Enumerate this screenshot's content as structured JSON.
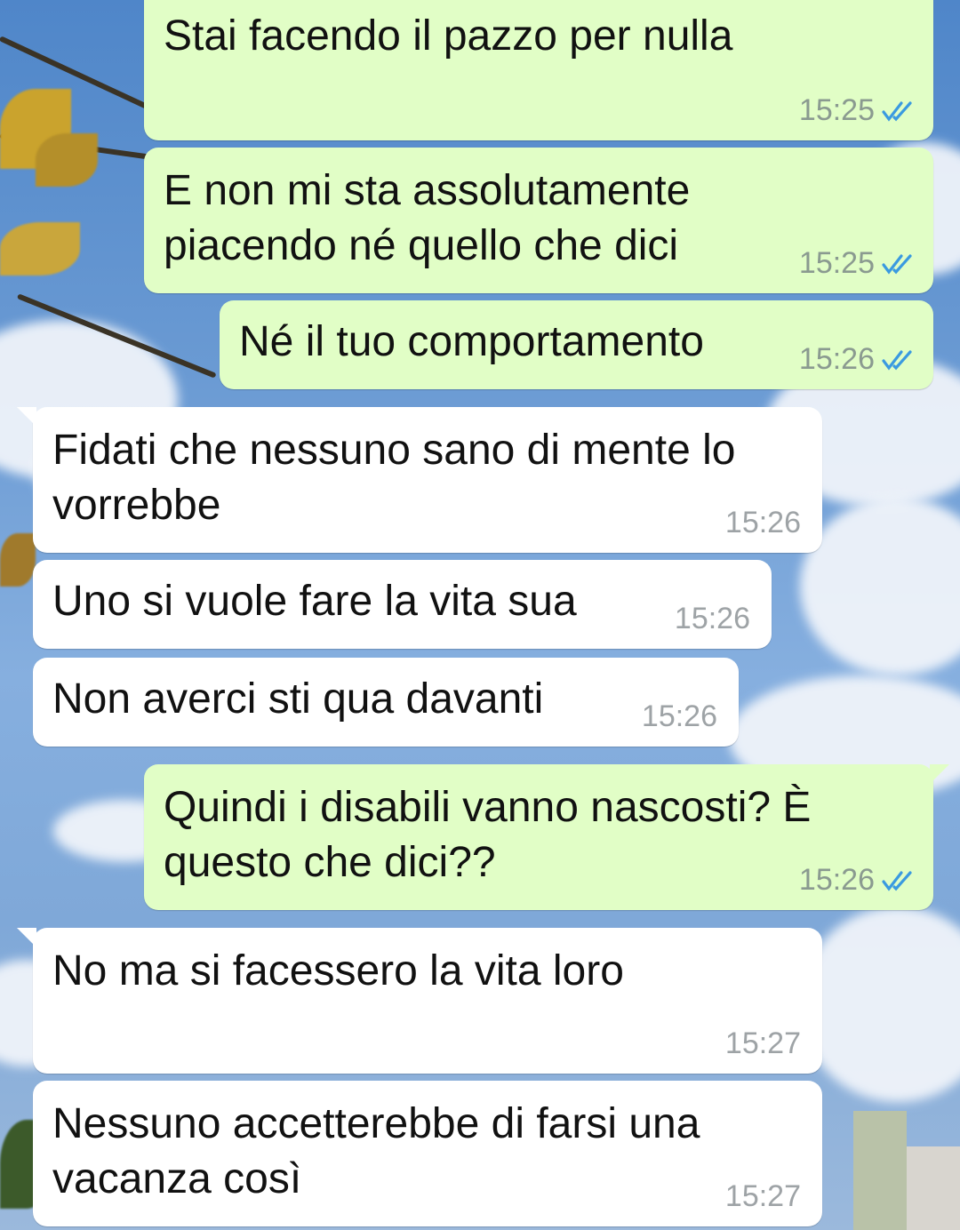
{
  "messages": [
    {
      "direction": "out",
      "text": "Stai facendo il pazzo per nulla",
      "time": "15:25",
      "status": "read"
    },
    {
      "direction": "out",
      "text": "E non mi sta assolutamente\npiacendo né quello che dici",
      "time": "15:25",
      "status": "read"
    },
    {
      "direction": "out",
      "text": "Né il tuo comportamento",
      "time": "15:26",
      "status": "read"
    },
    {
      "direction": "in",
      "text": "Fidati che nessuno sano di mente lo\nvorrebbe",
      "time": "15:26"
    },
    {
      "direction": "in",
      "text": "Uno si vuole fare la vita sua",
      "time": "15:26"
    },
    {
      "direction": "in",
      "text": "Non averci sti qua davanti",
      "time": "15:26"
    },
    {
      "direction": "out",
      "text": "Quindi i disabili vanno nascosti? È\nquesto che dici??",
      "time": "15:26",
      "status": "read"
    },
    {
      "direction": "in",
      "text": "No ma si facessero la vita loro",
      "time": "15:27"
    },
    {
      "direction": "in",
      "text": "Nessuno accetterebbe di farsi una\nvacanza così",
      "time": "15:27"
    }
  ],
  "colors": {
    "outgoing_bubble": "#e1fec6",
    "incoming_bubble": "#ffffff",
    "read_ticks": "#3a9ae0"
  },
  "icons": {
    "read_status": "double-check-icon"
  }
}
